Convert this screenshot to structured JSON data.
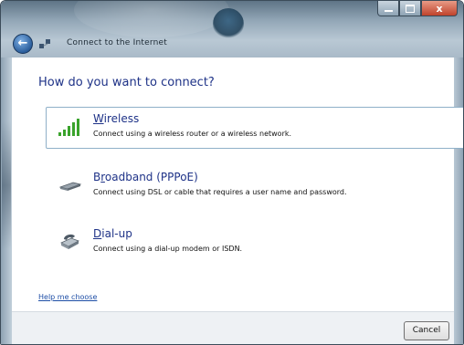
{
  "window": {
    "title": "Connect to the Internet",
    "controls": {
      "minimize_icon": "minimize-icon",
      "maximize_icon": "maximize-icon",
      "close_icon": "close-icon",
      "close_glyph": "x"
    },
    "back_icon": "back-arrow-icon",
    "title_icon": "network-icon"
  },
  "main": {
    "heading": "How do you want to connect?",
    "options": [
      {
        "key": "wireless",
        "icon": "wireless-signal-icon",
        "label_accel": "W",
        "label_rest": "ireless",
        "description": "Connect using a wireless router or a wireless network.",
        "selected": true
      },
      {
        "key": "broadband",
        "icon": "broadband-modem-icon",
        "label_pre": "B",
        "label_accel": "r",
        "label_rest": "oadband (PPPoE)",
        "description": "Connect using DSL or cable that requires a user name and password.",
        "selected": false
      },
      {
        "key": "dialup",
        "icon": "dialup-phone-icon",
        "label_accel": "D",
        "label_rest": "ial-up",
        "description": "Connect using a dial-up modem or ISDN.",
        "selected": false
      }
    ],
    "help_link": "Help me choose"
  },
  "footer": {
    "cancel_label": "Cancel"
  },
  "colors": {
    "heading": "#1e3287",
    "link": "#1e4ea6",
    "selected_border": "#8fb0c8",
    "wireless_green": "#3aa32c"
  }
}
